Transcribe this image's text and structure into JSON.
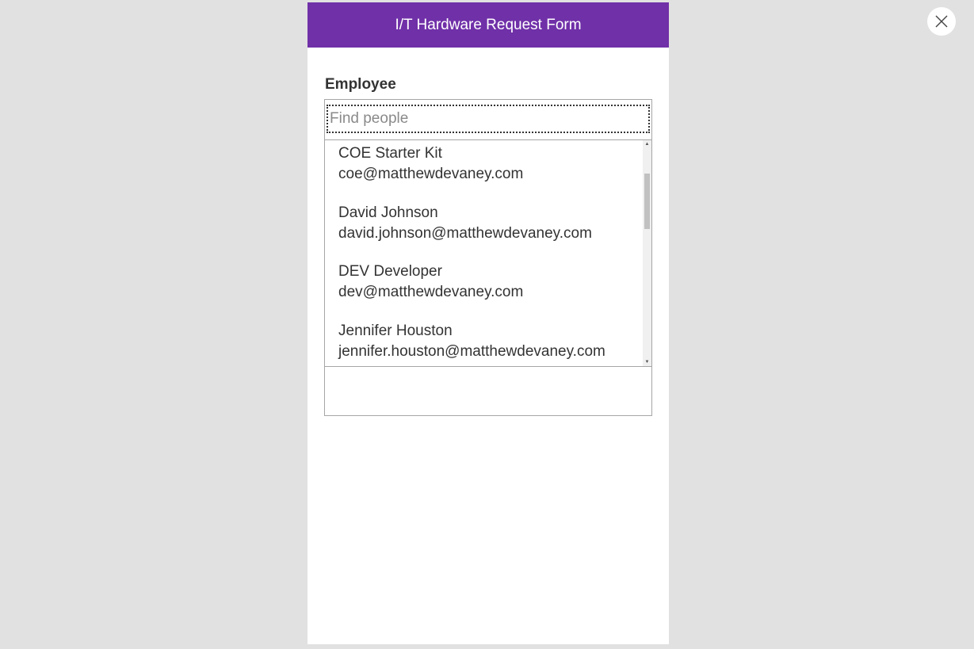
{
  "header": {
    "title": "I/T Hardware Request Form"
  },
  "form": {
    "employee_label": "Employee",
    "search_placeholder": "Find people",
    "search_value": ""
  },
  "people": [
    {
      "name": "COE Starter Kit",
      "email": "coe@matthewdevaney.com"
    },
    {
      "name": "David Johnson",
      "email": "david.johnson@matthewdevaney.com"
    },
    {
      "name": "DEV Developer",
      "email": "dev@matthewdevaney.com"
    },
    {
      "name": "Jennifer Houston",
      "email": "jennifer.houston@matthewdevaney.com"
    }
  ],
  "icons": {
    "close": "close-icon",
    "scroll_up": "scroll-up-arrow-icon",
    "scroll_down": "scroll-down-arrow-icon"
  },
  "colors": {
    "header_bg": "#7030a8",
    "page_bg": "#e1e1e1",
    "text": "#333333"
  }
}
